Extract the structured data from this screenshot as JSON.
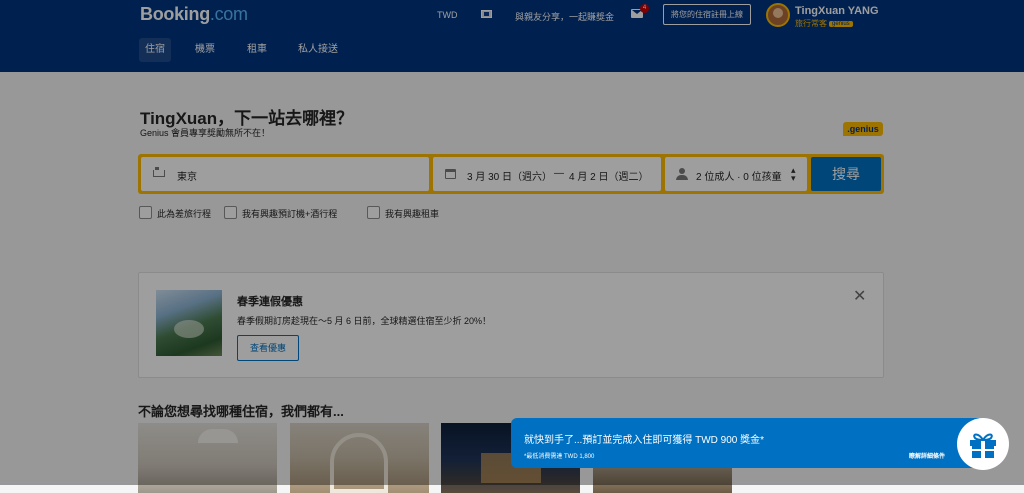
{
  "header": {
    "logo_main": "Booking",
    "logo_dot": ".com",
    "currency": "TWD",
    "share_text": "與親友分享，一起賺獎金",
    "inbox_count": "4",
    "list_property": "將您的住宿註冊上線",
    "user_name": "TingXuan YANG",
    "user_level": "旅行常客",
    "user_genius": "genius"
  },
  "nav": {
    "items": [
      {
        "label": "住宿"
      },
      {
        "label": "機票"
      },
      {
        "label": "租車"
      },
      {
        "label": "私人接送"
      }
    ]
  },
  "hero": {
    "title": "TingXuan，下一站去哪裡？",
    "subtitle": "Genius 會員專享獎勵無所不在！",
    "genius_tag": ".genius"
  },
  "search": {
    "destination": "東京",
    "checkin": "3 月 30 日（週六）",
    "date_sep": "—",
    "checkout": "4 月 2 日（週二）",
    "guests": "2 位成人 · 0 位孩童",
    "button": "搜尋"
  },
  "options": [
    {
      "label": "此為差旅行程"
    },
    {
      "label": "我有興趣預訂機+酒行程"
    },
    {
      "label": "我有興趣租車"
    }
  ],
  "promo": {
    "title": "春季連假優惠",
    "description": "春季假期訂房趁現在～5 月 6 日前，全球精選住宿至少折 20%！",
    "button": "查看優惠"
  },
  "section": {
    "title": "不論您想尋找哪種住宿，我們都有..."
  },
  "notification": {
    "message": "就快到手了...預訂並完成入住即可獲得 TWD 900 獎金*",
    "footnote": "*最低消費需達 TWD 1,800",
    "link": "瞭解詳細條件"
  },
  "colors": {
    "brand_blue": "#003580",
    "action_blue": "#0071c2",
    "genius_yellow": "#febb02"
  }
}
